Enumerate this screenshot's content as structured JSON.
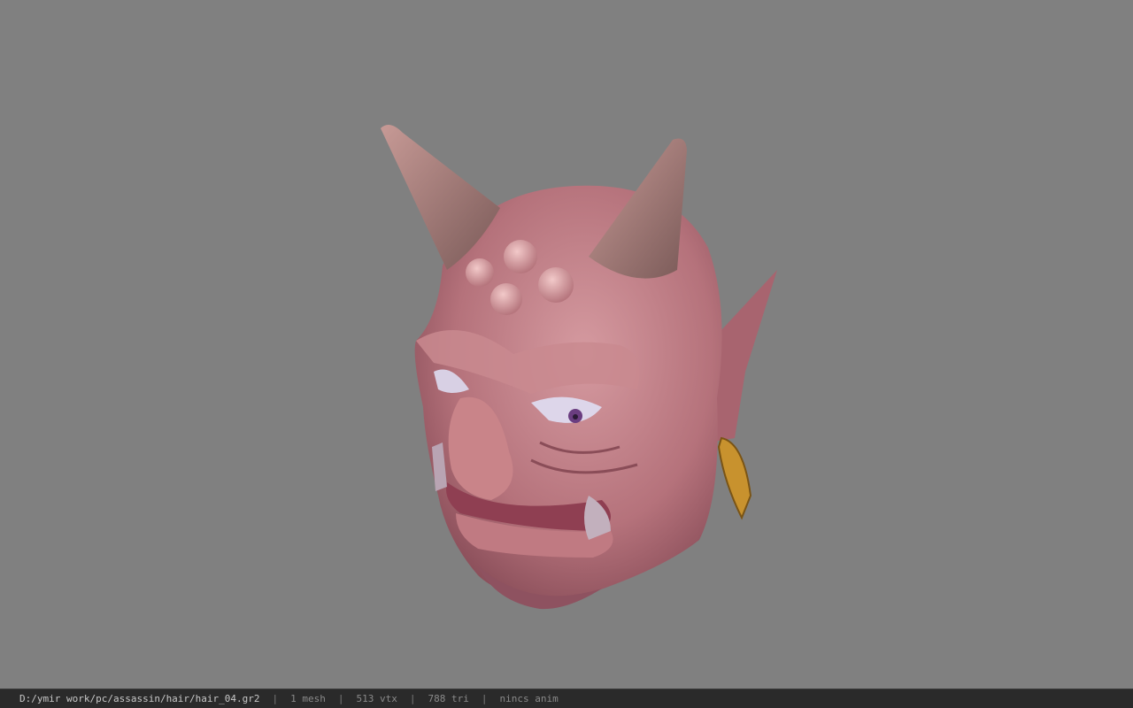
{
  "viewer": {
    "background_color": "#808080",
    "model_name": "oni-head"
  },
  "statusbar": {
    "file_path": "D:/ymir work/pc/assassin/hair/hair_04.gr2",
    "separator": "|",
    "mesh_count": "1 mesh",
    "vertex_count": "513 vtx",
    "triangle_count": "788 tri",
    "anim_info": "nincs anim"
  }
}
